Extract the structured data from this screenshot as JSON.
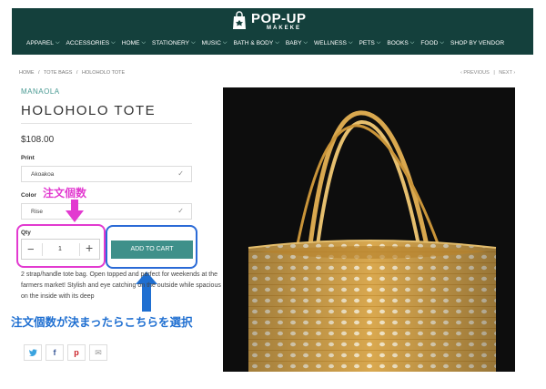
{
  "header": {
    "logo_main": "POP-UP",
    "logo_sub": "MAKEKE",
    "nav": [
      {
        "label": "APPAREL",
        "chev": true
      },
      {
        "label": "ACCESSORIES",
        "chev": true
      },
      {
        "label": "HOME",
        "chev": true
      },
      {
        "label": "STATIONERY",
        "chev": true
      },
      {
        "label": "MUSIC",
        "chev": true
      },
      {
        "label": "BATH & BODY",
        "chev": true
      },
      {
        "label": "BABY",
        "chev": true
      },
      {
        "label": "WELLNESS",
        "chev": true
      },
      {
        "label": "PETS",
        "chev": true
      },
      {
        "label": "BOOKS",
        "chev": true
      },
      {
        "label": "FOOD",
        "chev": true
      },
      {
        "label": "SHOP BY VENDOR",
        "chev": false
      }
    ]
  },
  "breadcrumb": {
    "home": "HOME",
    "sep": "/",
    "category": "TOTE BAGS",
    "current": "HOLOHOLO TOTE"
  },
  "pager": {
    "prev": "‹ PREVIOUS",
    "sep": "|",
    "next": "NEXT ›"
  },
  "product": {
    "vendor": "MANAOLA",
    "title": "HOLOHOLO TOTE",
    "price": "$108.00",
    "print_label": "Print",
    "print_value": "Akoakoa",
    "color_label": "Color",
    "color_value": "Rise",
    "qty_label": "Qty",
    "qty_value": "1",
    "add_to_cart": "ADD TO CART",
    "description": "2 strap/handle tote bag. Open topped and perfect for weekends at the farmers market! Stylish and eye catching on the outside while spacious on the inside with its deep"
  },
  "annotations": {
    "qty_note": "注文個数",
    "cart_note": "注文個数が決まったらこちらを選択",
    "qty_color": "#e23ad0",
    "cart_color": "#2a6ad6"
  },
  "share": {
    "twitter": "t",
    "facebook": "f",
    "pinterest": "p",
    "email": "✉"
  },
  "colors": {
    "header_bg": "#14403c",
    "accent": "#3f908a",
    "vendor": "#4a9a93"
  }
}
